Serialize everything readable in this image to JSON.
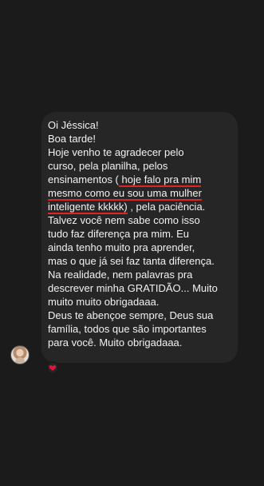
{
  "message": {
    "lines": [
      "Oi Jéssica!",
      "Boa tarde!",
      "Hoje venho te agradecer pelo",
      "curso, pela planilha, pelos",
      "ensinamentos (",
      " hoje falo pra mim",
      "mesmo como eu sou uma mulher",
      "inteligente kkkkk)",
      " , pela paciência.",
      "Talvez você nem sabe como isso",
      "tudo faz diferença pra mim. Eu",
      "ainda tenho muito pra aprender,",
      "mas o que já sei faz tanta diferença.",
      "Na realidade, nem palavras pra",
      "descrever minha GRATIDÃO... Muito",
      "muito muito obrigadaaa.",
      "Deus te abençoe sempre, Deus sua",
      "família, todos que são importantes",
      "para você. Muito obrigadaaa."
    ]
  },
  "reaction": {
    "icon": "heart-icon",
    "color": "#e0143c"
  },
  "avatar": {
    "icon": "user-avatar"
  }
}
